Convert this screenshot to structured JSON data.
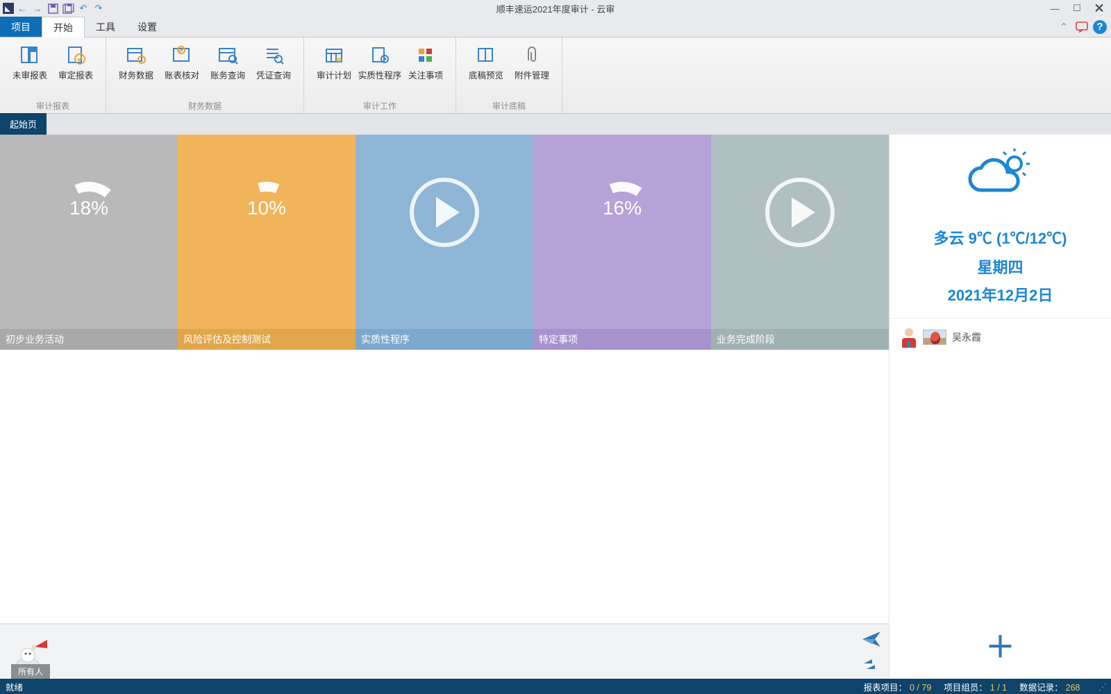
{
  "app": {
    "title": "顺丰速运2021年度审计 - 云审"
  },
  "qat": {
    "back": "←",
    "forward": "→",
    "save": "💾",
    "saveall": "💾",
    "undo": "↶",
    "redo": "↷"
  },
  "win": {
    "min": "—",
    "max": "☐",
    "close": "✕"
  },
  "menu_right": {
    "collapse": "⌃",
    "chat": "💬",
    "help": "?"
  },
  "menutabs": {
    "project": "项目",
    "start": "开始",
    "tools": "工具",
    "settings": "设置"
  },
  "ribbon": {
    "groups": [
      {
        "label": "审计报表",
        "buttons": [
          {
            "label": "未审报表",
            "icon": "sheet-blue"
          },
          {
            "label": "审定报表",
            "icon": "sheet-check"
          }
        ]
      },
      {
        "label": "财务数据",
        "buttons": [
          {
            "label": "财务数据",
            "icon": "table-gear"
          },
          {
            "label": "账表核对",
            "icon": "table-check"
          },
          {
            "label": "账务查询",
            "icon": "table-search"
          },
          {
            "label": "凭证查询",
            "icon": "list-search"
          }
        ]
      },
      {
        "label": "审计工作",
        "buttons": [
          {
            "label": "审计计划",
            "icon": "calendar"
          },
          {
            "label": "实质性程序",
            "icon": "sheet-zoom"
          },
          {
            "label": "关注事项",
            "icon": "grid-color"
          }
        ]
      },
      {
        "label": "审计底稿",
        "buttons": [
          {
            "label": "底稿预览",
            "icon": "book"
          },
          {
            "label": "附件管理",
            "icon": "clip"
          }
        ]
      }
    ]
  },
  "pagetab": {
    "start": "起始页"
  },
  "tiles": [
    {
      "label": "初步业务活动",
      "percent": "18%",
      "arc_deg": 65,
      "kind": "arc"
    },
    {
      "label": "风险评估及控制测试",
      "percent": "10%",
      "arc_deg": 36,
      "kind": "arc"
    },
    {
      "label": "实质性程序",
      "kind": "play"
    },
    {
      "label": "特定事项",
      "percent": "16%",
      "arc_deg": 58,
      "kind": "arc"
    },
    {
      "label": "业务完成阶段",
      "kind": "play"
    }
  ],
  "chat": {
    "all_label": "所有人"
  },
  "weather": {
    "summary": "多云 9℃ (1℃/12℃)",
    "weekday": "星期四",
    "date": "2021年12月2日"
  },
  "user": {
    "name": "吴永霞"
  },
  "status": {
    "ready": "就绪",
    "report_label": "报表项目：",
    "report_value": "0 / 79",
    "team_label": "项目组员：",
    "team_value": "1 / 1",
    "record_label": "数据记录：",
    "record_value": "268"
  }
}
